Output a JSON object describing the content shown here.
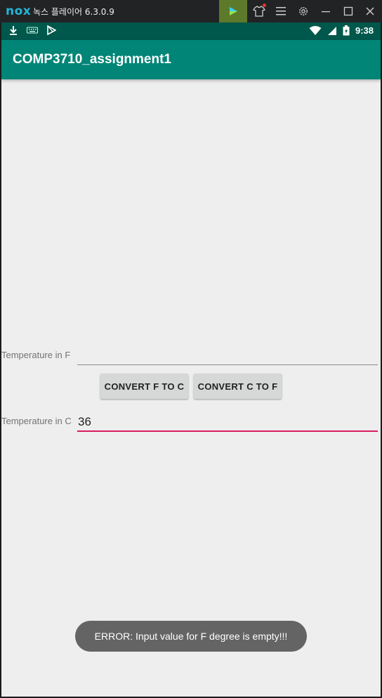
{
  "window": {
    "logo": "nox",
    "title": "녹스 플레이어 6.3.0.9",
    "icons": [
      "play-icon",
      "shirt-icon",
      "menu-icon",
      "gear-icon",
      "minimize-icon",
      "maximize-icon",
      "close-icon"
    ]
  },
  "status_bar": {
    "left_icons": [
      "download-icon",
      "keyboard-icon",
      "play-store-icon"
    ],
    "right_icons": [
      "wifi-icon",
      "cell-signal-icon",
      "battery-icon"
    ],
    "time": "9:38"
  },
  "app_bar": {
    "title": "COMP3710_assignment1"
  },
  "form": {
    "f_label": "Temperature in F",
    "f_value": "",
    "c_label": "Temperature in C",
    "c_value": "36",
    "convert_f_to_c": "CONVERT F TO C",
    "convert_c_to_f": "CONVERT C TO F"
  },
  "toast": {
    "message": "ERROR: Input value for F degree is empty!!!"
  },
  "colors": {
    "primary": "#008577",
    "primary_dark": "#00574b",
    "accent": "#d81b60",
    "background": "#eeeeee"
  }
}
